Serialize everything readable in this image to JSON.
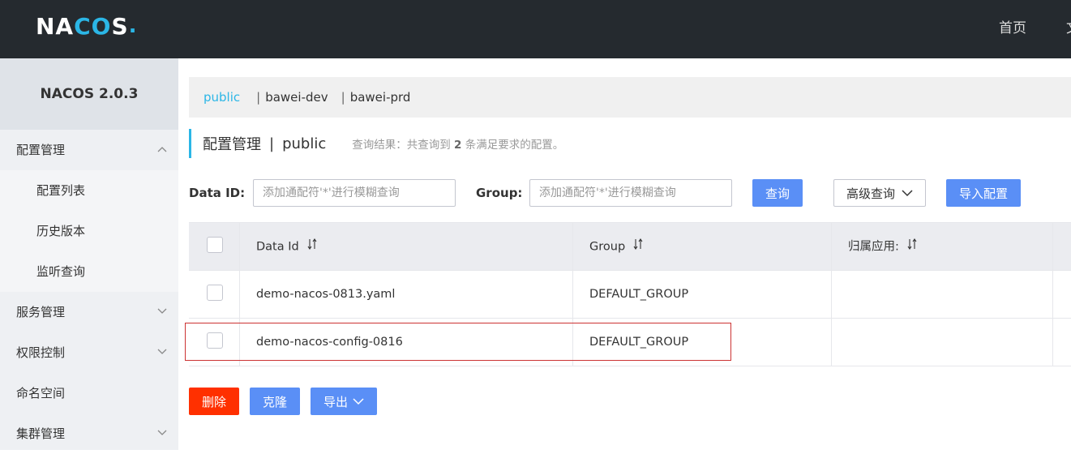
{
  "header": {
    "logo": {
      "n": "NA",
      "o": "CO",
      "s": "S",
      "dot": "."
    },
    "nav": [
      "首页",
      "文"
    ]
  },
  "sidebar": {
    "version": "NACOS 2.0.3",
    "items": [
      {
        "label": "配置管理",
        "chevron": "up"
      },
      {
        "label": "配置列表"
      },
      {
        "label": "历史版本"
      },
      {
        "label": "监听查询"
      },
      {
        "label": "服务管理",
        "chevron": "down"
      },
      {
        "label": "权限控制",
        "chevron": "down"
      },
      {
        "label": "命名空间"
      },
      {
        "label": "集群管理",
        "chevron": "down"
      }
    ]
  },
  "namespaces": {
    "active": "public",
    "others": [
      "bawei-dev",
      "bawei-prd"
    ],
    "separator": "|"
  },
  "page": {
    "title": "配置管理",
    "separator": "|",
    "namespace": "public",
    "result_prefix": "查询结果：共查询到 ",
    "result_count": "2",
    "result_suffix": " 条满足要求的配置。"
  },
  "search": {
    "data_id_label": "Data ID:",
    "data_id_placeholder": "添加通配符'*'进行模糊查询",
    "group_label": "Group:",
    "group_placeholder": "添加通配符'*'进行模糊查询",
    "query_button": "查询",
    "advanced_button": "高级查询",
    "import_button": "导入配置"
  },
  "table": {
    "columns": [
      "Data Id",
      "Group",
      "归属应用:"
    ],
    "rows": [
      {
        "data_id": "demo-nacos-0813.yaml",
        "group": "DEFAULT_GROUP",
        "app": ""
      },
      {
        "data_id": "demo-nacos-config-0816",
        "group": "DEFAULT_GROUP",
        "app": ""
      }
    ]
  },
  "actions": {
    "delete": "删除",
    "clone": "克隆",
    "export": "导出"
  },
  "colors": {
    "accent": "#2bb6e6",
    "primary": "#5a8ff6",
    "danger": "#ff3000",
    "header_bg": "#252a2f"
  }
}
